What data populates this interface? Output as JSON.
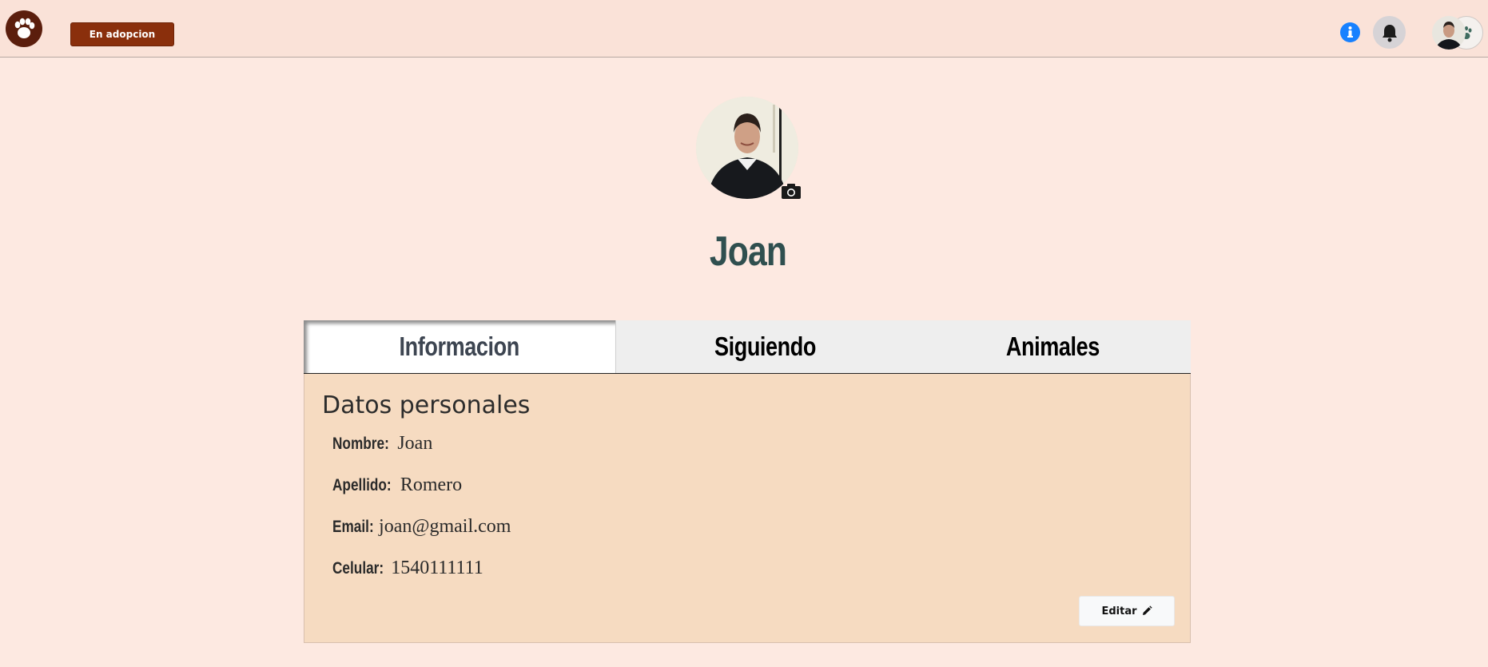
{
  "navbar": {
    "logo_icon": "paw-icon",
    "adopt_label": "En adopcion",
    "info_icon": "info-icon",
    "bell_icon": "bell-icon",
    "pet_icon": "paw-icon"
  },
  "profile": {
    "name": "Joan",
    "camera_icon": "camera-icon"
  },
  "tabs": [
    {
      "label": "Informacion",
      "active": true
    },
    {
      "label": "Siguiendo",
      "active": false
    },
    {
      "label": "Animales",
      "active": false
    }
  ],
  "panel": {
    "title": "Datos personales",
    "fields": [
      {
        "label": "Nombre:",
        "value": "Joan"
      },
      {
        "label": "Apellido:",
        "value": "Romero"
      },
      {
        "label": "Email:",
        "value": "joan@gmail.com"
      },
      {
        "label": "Celular:",
        "value": "1540111111"
      }
    ],
    "edit_label": "Editar",
    "edit_icon": "pencil-icon"
  },
  "colors": {
    "page_bg": "#fde9e1",
    "navbar_bg": "#fae2d8",
    "adopt_button": "#8a2f0c",
    "info_blue": "#1781ff",
    "name_color": "#2f4f4f",
    "panel_bg": "#f6dbc1"
  }
}
